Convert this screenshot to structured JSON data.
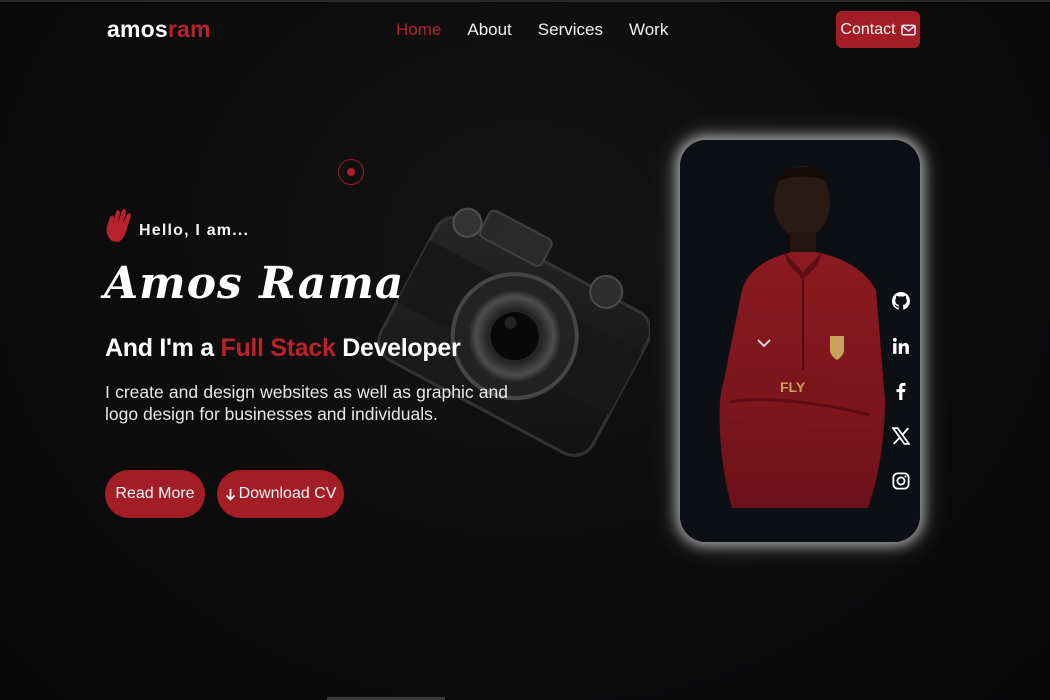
{
  "header": {
    "logo_main": "amos",
    "logo_accent": "ram",
    "nav": [
      "Home",
      "About",
      "Services",
      "Work"
    ],
    "active_nav": "Home",
    "contact_label": "Contact"
  },
  "hero": {
    "greeting": "Hello, I am...",
    "name": "Amos Rama",
    "role_prefix": "And I'm a ",
    "role_highlight": "Full Stack",
    "role_suffix": " Developer",
    "description": "I create and design websites as well as graphic and logo design for businesses and individuals.",
    "read_more_label": "Read More",
    "download_cv_label": "Download CV"
  },
  "socials": [
    "github-icon",
    "linkedin-icon",
    "facebook-icon",
    "x-icon",
    "instagram-icon"
  ],
  "colors": {
    "accent": "#b8222c",
    "button": "#a31d27",
    "background": "#0b0b0c",
    "card": "#0d1014"
  }
}
